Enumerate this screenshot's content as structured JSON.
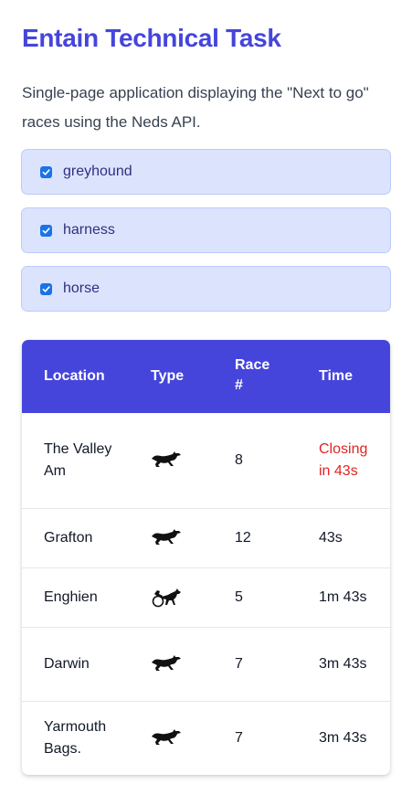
{
  "header": {
    "title": "Entain Technical Task",
    "description": "Single-page application displaying the \"Next to go\" races using the Neds API."
  },
  "filters": [
    {
      "label": "greyhound",
      "checked": true
    },
    {
      "label": "harness",
      "checked": true
    },
    {
      "label": "horse",
      "checked": true
    }
  ],
  "table": {
    "columns": {
      "location": "Location",
      "type": "Type",
      "race": "Race #",
      "time": "Time"
    },
    "rows": [
      {
        "location": "The Valley Am",
        "type_icon": "greyhound-icon",
        "race": "8",
        "time": "Closing in 43s",
        "closing": true
      },
      {
        "location": "Grafton",
        "type_icon": "greyhound-icon",
        "race": "12",
        "time": "43s",
        "closing": false
      },
      {
        "location": "Enghien",
        "type_icon": "harness-icon",
        "race": "5",
        "time": "1m 43s",
        "closing": false
      },
      {
        "location": "Darwin",
        "type_icon": "greyhound-icon",
        "race": "7",
        "time": "3m 43s",
        "closing": false
      },
      {
        "location": "Yarmouth Bags.",
        "type_icon": "greyhound-icon",
        "race": "7",
        "time": "3m 43s",
        "closing": false
      }
    ]
  },
  "colors": {
    "brand": "#4545dc",
    "filter_bg": "#dce4fd",
    "closing": "#e02424"
  }
}
